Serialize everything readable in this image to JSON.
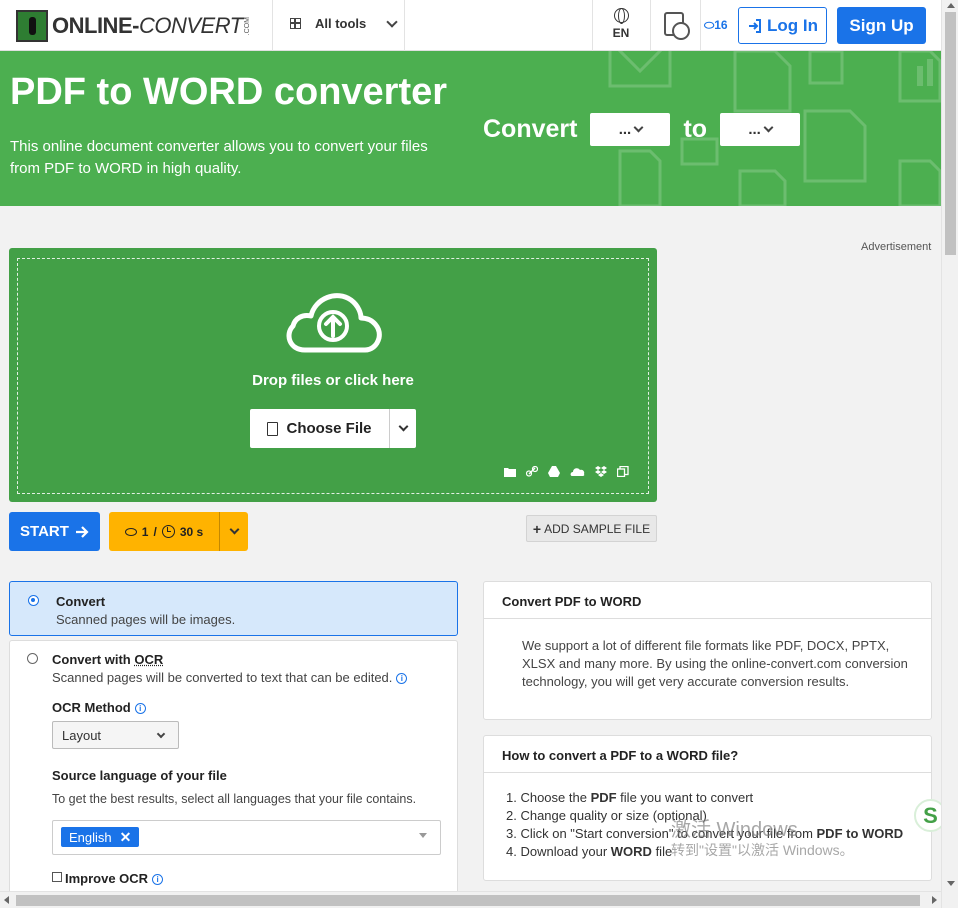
{
  "header": {
    "logo_main": "ONLINE-",
    "logo_italic": "CONVERT",
    "logo_suffix": ".COM",
    "all_tools_label": "All tools",
    "language_label": "EN",
    "credits_count": "16",
    "login_label": "Log In",
    "signup_label": "Sign Up"
  },
  "hero": {
    "title": "PDF to WORD converter",
    "description": "This online document converter allows you to convert your files from PDF to WORD in high quality.",
    "convert_label": "Convert",
    "to_label": "to",
    "from_select_value": "...",
    "to_select_value": "..."
  },
  "advertisement_label": "Advertisement",
  "dropzone": {
    "prompt": "Drop files or click here",
    "choose_file_label": "Choose File"
  },
  "actions": {
    "start_label": "START",
    "credits_cost": "1",
    "cost_separator": "/",
    "time_cost": "30 s",
    "add_sample_label": "ADD SAMPLE FILE"
  },
  "options": {
    "convert_title": "Convert",
    "convert_desc": "Scanned pages will be images.",
    "ocr_title_prefix": "Convert with ",
    "ocr_title_suffix": "OCR",
    "ocr_desc": "Scanned pages will be converted to text that can be edited.",
    "ocr_method_label": "OCR Method",
    "ocr_method_value": "Layout",
    "source_lang_label": "Source language of your file",
    "source_lang_help": "To get the best results, select all languages that your file contains.",
    "selected_language": "English",
    "improve_ocr_label": "Improve OCR"
  },
  "info_panel": {
    "title": "Convert PDF to WORD",
    "body": "We support a lot of different file formats like PDF, DOCX, PPTX, XLSX and many more. By using the online-convert.com conversion technology, you will get very accurate conversion results."
  },
  "howto_panel": {
    "title": "How to convert a PDF to a WORD file?",
    "step1_a": "1. Choose the ",
    "step1_b": "PDF",
    "step1_c": " file you want to convert",
    "step2": "2. Change quality or size (optional)",
    "step3_a": "3. Click on \"Start conversion\" to convert your file from ",
    "step3_b": "PDF to WORD",
    "step4_a": "4. Download your ",
    "step4_b": "WORD",
    "step4_c": " file"
  },
  "watermark": {
    "line1": "激活 Windows",
    "line2": "转到\"设置\"以激活 Windows。"
  },
  "colors": {
    "brand_green": "#4caf50",
    "dropzone_green": "#43a047",
    "primary_blue": "#1a73e8",
    "cost_orange": "#ffb300"
  }
}
